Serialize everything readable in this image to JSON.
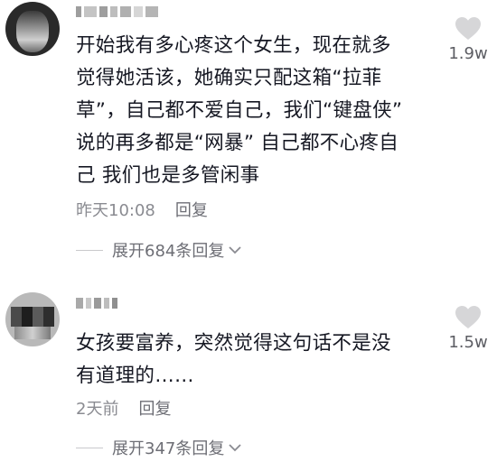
{
  "comments": [
    {
      "text": "开始我有多心疼这个女生，现在就多\n觉得她活该，她确实只配这箱“拉菲\n草”，自己都不爱自己，我们“键盘侠”\n说的再多都是“网暴” 自己都不心疼自\n己 我们也是多管闲事",
      "time": "昨天10:08",
      "reply_label": "回复",
      "expand_label": "展开684条回复",
      "likes": "1.9w",
      "like_icon": "heart-icon"
    },
    {
      "text": "女孩要富养，突然觉得这句话不是没\n有道理的……",
      "time": "2天前",
      "reply_label": "回复",
      "expand_label": "展开347条回复",
      "likes": "1.5w",
      "like_icon": "heart-icon"
    }
  ]
}
